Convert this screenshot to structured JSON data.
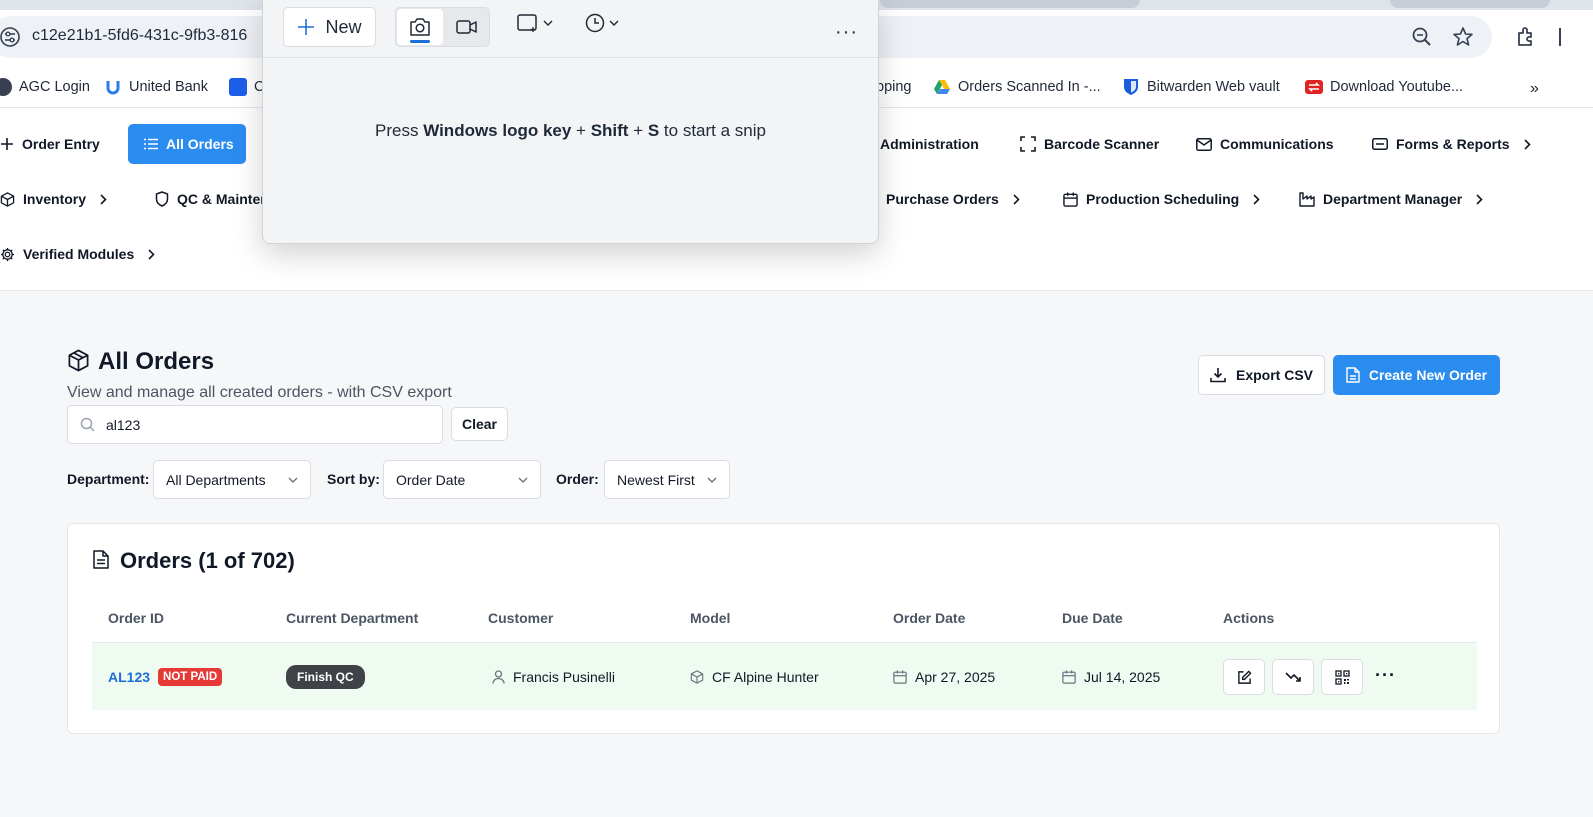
{
  "browser": {
    "url": "c12e21b1-5fd6-431c-9fb3-816",
    "bookmarks": [
      {
        "label": "AGC Login",
        "color": "#374151"
      },
      {
        "label": "United Bank",
        "color": "#2b7de9"
      },
      {
        "label": "C",
        "color": "#1d5ee8"
      },
      {
        "label": "pping",
        "color": ""
      },
      {
        "label": "Orders Scanned In -...",
        "color": "#1fa463"
      },
      {
        "label": "Bitwarden Web vault",
        "color": "#175ddc"
      },
      {
        "label": "Download Youtube...",
        "color": "#e02424"
      }
    ],
    "more": "»"
  },
  "nav": {
    "order_entry": "Order Entry",
    "all_orders": "All Orders",
    "administration": "Administration",
    "barcode_scanner": "Barcode Scanner",
    "communications": "Communications",
    "forms_reports": "Forms & Reports",
    "inventory": "Inventory",
    "qc_maintenance": "QC & Mainter",
    "purchase_orders": "Purchase Orders",
    "production_scheduling": "Production Scheduling",
    "department_manager": "Department Manager",
    "verified_modules": "Verified Modules"
  },
  "snip": {
    "new_label": "New",
    "hint_prefix": "Press ",
    "hint_key1": "Windows logo key",
    "hint_plus1": " + ",
    "hint_key2": "Shift",
    "hint_plus2": " + ",
    "hint_key3": "S",
    "hint_suffix": " to start a snip",
    "more": "···"
  },
  "page": {
    "title": "All Orders",
    "subtitle": "View and manage all created orders - with CSV export",
    "export_label": "Export CSV",
    "create_label": "Create New Order",
    "search_value": "al123",
    "clear_label": "Clear"
  },
  "filters": {
    "department_label": "Department:",
    "department_value": "All Departments",
    "sort_label": "Sort by:",
    "sort_value": "Order Date",
    "order_label": "Order:",
    "order_value": "Newest First"
  },
  "orders": {
    "title": "Orders (1 of 702)",
    "columns": [
      "Order ID",
      "Current Department",
      "Customer",
      "Model",
      "Order Date",
      "Due Date",
      "Actions"
    ],
    "rows": [
      {
        "order_id": "AL123",
        "paid_badge": "NOT PAID",
        "department": "Finish QC",
        "customer": "Francis Pusinelli",
        "model": "CF Alpine Hunter",
        "order_date": "Apr 27, 2025",
        "due_date": "Jul 14, 2025",
        "more": "···"
      }
    ]
  },
  "colors": {
    "accent": "#2b8cf0",
    "row_highlight": "#effaf1",
    "badge_red": "#e53935",
    "badge_dark": "#3f4347"
  }
}
